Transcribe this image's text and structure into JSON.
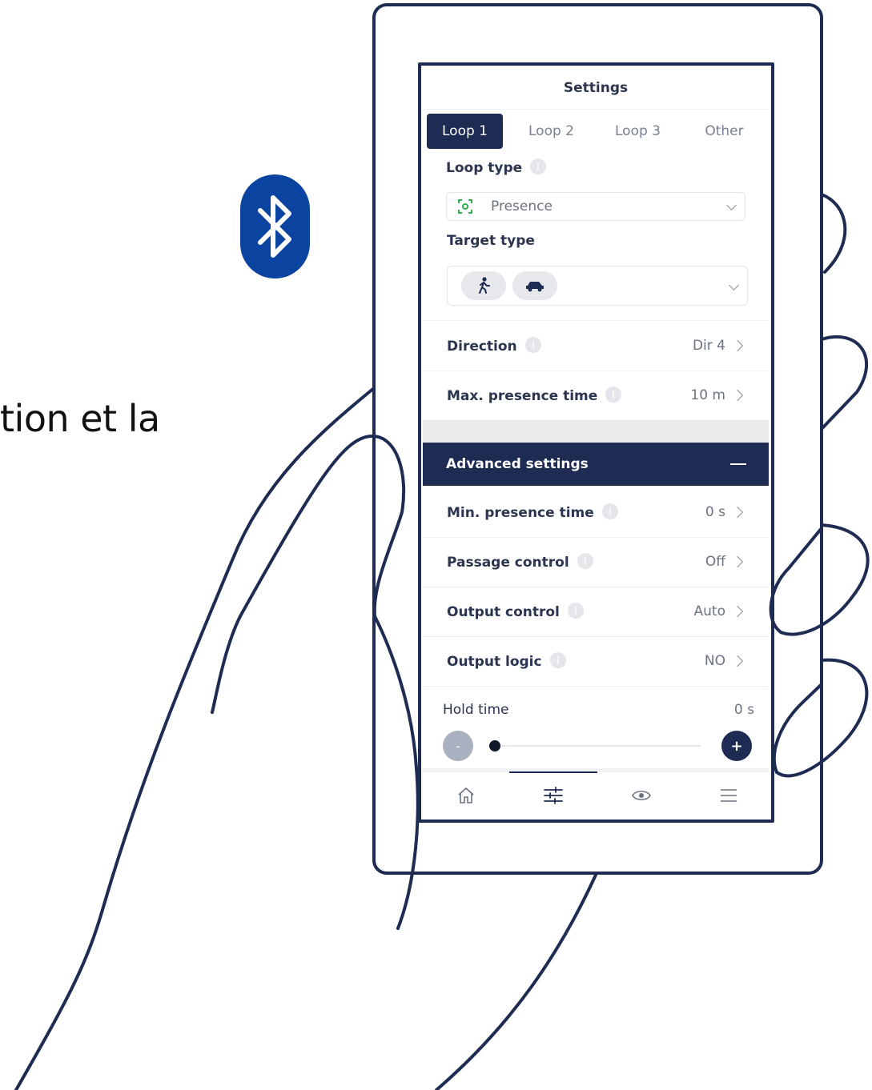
{
  "caption": "tion et la",
  "colors": {
    "navy": "#1e2b52",
    "bluetooth_blue": "#0b43a0",
    "presence_green": "#2db34a"
  },
  "screen": {
    "title": "Settings",
    "tabs": [
      {
        "label": "Loop 1",
        "active": true
      },
      {
        "label": "Loop 2",
        "active": false
      },
      {
        "label": "Loop 3",
        "active": false
      },
      {
        "label": "Other",
        "active": false
      }
    ],
    "loop_type": {
      "label": "Loop type",
      "value": "Presence",
      "icon": "presence-icon"
    },
    "target_type": {
      "label": "Target type",
      "options": [
        "pedestrian-icon",
        "car-icon"
      ]
    },
    "direction": {
      "label": "Direction",
      "value": "Dir 4"
    },
    "max_presence": {
      "label": "Max. presence time",
      "value": "10 m"
    },
    "advanced": {
      "label": "Advanced settings",
      "toggle": "—"
    },
    "min_presence": {
      "label": "Min. presence time",
      "value": "0 s"
    },
    "passage": {
      "label": "Passage control",
      "value": "Off"
    },
    "output_control": {
      "label": "Output control",
      "value": "Auto"
    },
    "output_logic": {
      "label": "Output logic",
      "value": "NO"
    },
    "hold_time": {
      "label": "Hold time",
      "value": "0 s",
      "minus": "-",
      "plus": "+",
      "level": 0
    },
    "nav": [
      "home-icon",
      "sliders-icon",
      "eye-icon",
      "menu-icon"
    ],
    "active_nav": "sliders-icon"
  }
}
